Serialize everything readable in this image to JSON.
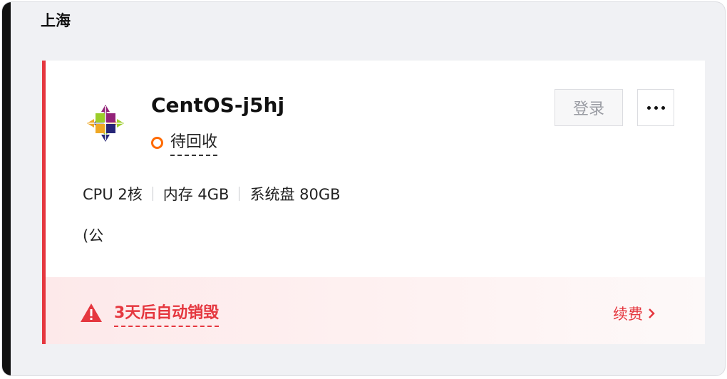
{
  "region": {
    "title": "上海"
  },
  "instance": {
    "name": "CentOS-j5hj",
    "status": "待回收",
    "specs": {
      "cpu": "CPU 2核",
      "memory": "内存 4GB",
      "disk": "系统盘 80GB"
    },
    "ip_text": "(公",
    "os_icon": "centos-logo-icon",
    "status_icon": "status-ring-icon"
  },
  "actions": {
    "login_label": "登录",
    "more_icon": "more-dots-icon"
  },
  "footer": {
    "warning_text": "3天后自动销毁",
    "warning_icon": "warning-triangle-icon",
    "renew_label": "续费",
    "renew_icon": "chevron-right-icon"
  },
  "colors": {
    "accent_red": "#e5373f",
    "status_orange": "#ff6a00",
    "panel_bg": "#f0f1f4"
  }
}
